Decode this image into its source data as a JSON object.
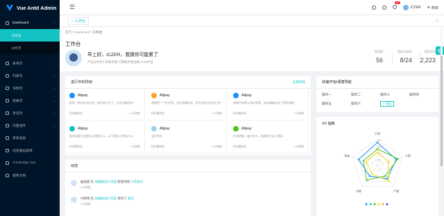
{
  "app": {
    "title": "Vue Antd Admin"
  },
  "sidebar": {
    "items": [
      {
        "label": "Dashboard",
        "open": true
      },
      {
        "label": "工作台",
        "active": true
      },
      {
        "label": "分析页"
      },
      {
        "label": "表单页"
      },
      {
        "label": "列表页"
      },
      {
        "label": "详情页"
      },
      {
        "label": "结果页"
      },
      {
        "label": "异常页"
      },
      {
        "label": "内置组件"
      },
      {
        "label": "带参菜单"
      },
      {
        "label": "动态路由菜单"
      },
      {
        "label": "Ant Design Vue"
      },
      {
        "label": "使用文档"
      }
    ]
  },
  "header": {
    "user": "ICZER",
    "lang": "简体",
    "badge": "12"
  },
  "tabs": {
    "items": [
      {
        "label": "工作台"
      }
    ]
  },
  "page": {
    "breadcrumb": [
      "首页",
      "Dashboard",
      "工作台"
    ],
    "title": "工作台",
    "greeting": "早上好，ICZER，我猜你可能累了",
    "subtitle": "产品分析师 | 蚂蚁金服-计算服务事业群-VUE平台",
    "stats": [
      {
        "label": "项目数",
        "value": "56"
      },
      {
        "label": "团队内排名",
        "value": "8/24"
      },
      {
        "label": "项目访问",
        "value": "2,223"
      }
    ]
  },
  "projects": {
    "title": "进行中的项目",
    "all_label": "全部项目",
    "items": [
      {
        "name": "Alipay",
        "desc": "那是一种内在的东西，他们到达不了，也无法触及的",
        "team": "科学搬砖组",
        "time": "9 分钟前",
        "color": "#1890ff"
      },
      {
        "name": "Alipay",
        "desc": "希望是一个好东西，也许是最好的，好东西是不会消亡的",
        "team": "科学搬砖组",
        "time": "9 分钟前",
        "color": "#f5a623"
      },
      {
        "name": "Alipay",
        "desc": "城镇中有那么多的酒馆，她却偏偏走进了我的酒馆",
        "team": "科学搬砖组",
        "time": "9 分钟前",
        "color": "#1890ff"
      },
      {
        "name": "Alipay",
        "desc": "那时候我只会想自己想要什么，从不想自己拥有什么",
        "team": "科学搬砖组",
        "time": "9 分钟前",
        "color": "#13c2c2"
      },
      {
        "name": "Alipay",
        "desc": "凛冬将至",
        "team": "科学搬砖组",
        "time": "9 分钟前",
        "color": "#a0d0f0"
      },
      {
        "name": "Alipay",
        "desc": "生命就像一盒巧克力，结果往往出人意料",
        "team": "科学搬砖组",
        "time": "9 分钟前",
        "color": "#52c41a"
      }
    ]
  },
  "activity": {
    "title": "动态",
    "items": [
      {
        "user": "曲丽丽",
        "verb": "在",
        "group": "高逼格设计天团",
        "action": "新建项目",
        "target": "六月迭代",
        "time": "9 分钟前"
      },
      {
        "user": "付晓晓",
        "verb": "在",
        "group": "高逼格设计天团",
        "action": "发布了",
        "target": "留言",
        "time": "9 分钟前"
      }
    ]
  },
  "quicknav": {
    "title": "快速开始/便捷导航",
    "items": [
      "操作一",
      "操作二",
      "操作三",
      "操作四",
      "操作五",
      "操作六"
    ],
    "add_label": "+ 添加"
  },
  "radar": {
    "title": "XX 指数",
    "axes": [
      "引用",
      "口碑",
      "产量",
      "贡献",
      "热度"
    ],
    "ticks": [
      "80",
      "60",
      "40",
      "20"
    ]
  },
  "chart_data": {
    "type": "radar",
    "categories": [
      "引用",
      "口碑",
      "产量",
      "贡献",
      "热度"
    ],
    "series": [
      {
        "values": [
          70,
          60,
          50,
          40,
          60
        ],
        "color": "#1890ff"
      },
      {
        "values": [
          50,
          65,
          40,
          55,
          45
        ],
        "color": "#52c41a"
      },
      {
        "values": [
          40,
          35,
          60,
          30,
          35
        ],
        "color": "#fadb14"
      }
    ],
    "ylim": [
      0,
      80
    ]
  }
}
